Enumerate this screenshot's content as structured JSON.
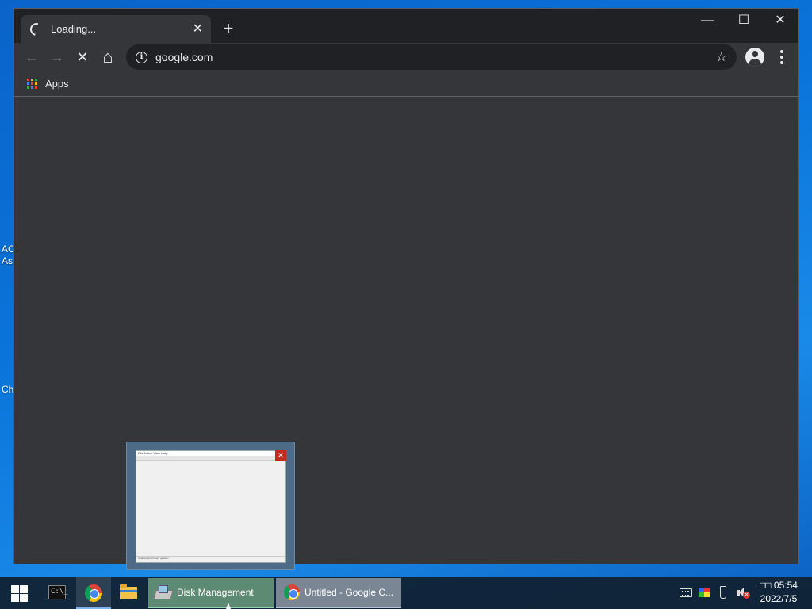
{
  "desktop": {
    "fragments": [
      "AC",
      "As",
      "Ch"
    ]
  },
  "browser": {
    "tab": {
      "title": "Loading...",
      "close": "✕"
    },
    "new_tab": "+",
    "window_controls": {
      "minimize": "—",
      "maximize": "☐",
      "close": "✕"
    },
    "nav": {
      "back": "←",
      "forward": "→",
      "stop": "✕",
      "home": "⌂"
    },
    "omnibox": {
      "info": "i",
      "url": "google.com",
      "star": "☆"
    },
    "bookmarks": {
      "apps_label": "Apps"
    },
    "apps_colors": [
      "#ea4335",
      "#fbbc04",
      "#34a853",
      "#4285f4",
      "#ea4335",
      "#fbbc04",
      "#34a853",
      "#4285f4",
      "#ea4335"
    ]
  },
  "preview": {
    "menu": "File  Action  View  Help",
    "close": "✕",
    "status": "Unallocated  Primary partition"
  },
  "taskbar": {
    "cmd_glyph": "C:\\_",
    "tasks": [
      {
        "label": "Disk Management"
      },
      {
        "label": "Untitled - Google C..."
      }
    ],
    "tray": {
      "mute_badge": "✕"
    },
    "clock": {
      "time": "□□ 05:54",
      "date": "2022/7/5"
    }
  }
}
